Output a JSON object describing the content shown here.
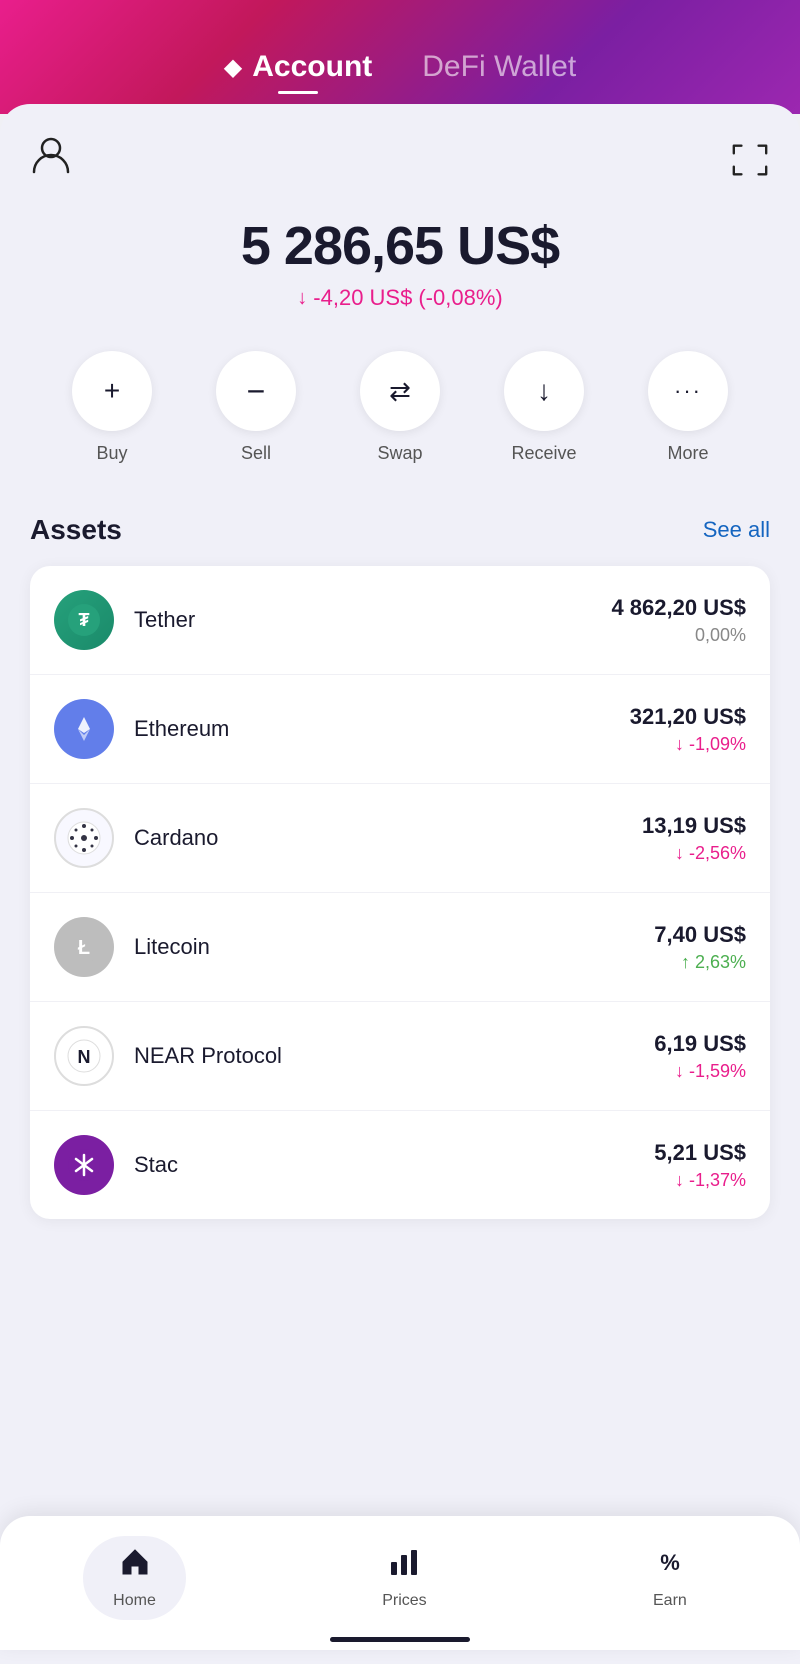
{
  "header": {
    "account_tab": "Account",
    "defi_tab": "DeFi Wallet",
    "diamond": "◆"
  },
  "balance": {
    "amount": "5 286,65 US$",
    "change": "-4,20 US$",
    "change_pct": "(-0,08%)",
    "change_direction": "down"
  },
  "actions": [
    {
      "id": "buy",
      "icon": "+",
      "label": "Buy"
    },
    {
      "id": "sell",
      "icon": "−",
      "label": "Sell"
    },
    {
      "id": "swap",
      "icon": "⇄",
      "label": "Swap"
    },
    {
      "id": "receive",
      "icon": "↓",
      "label": "Receive"
    },
    {
      "id": "more",
      "icon": "···",
      "label": "More"
    }
  ],
  "assets_section": {
    "title": "Assets",
    "see_all": "See all"
  },
  "assets": [
    {
      "id": "tether",
      "name": "Tether",
      "value": "4 862,20 US$",
      "change": "0,00%",
      "direction": "neutral",
      "icon_letter": "T",
      "icon_style": "tether"
    },
    {
      "id": "ethereum",
      "name": "Ethereum",
      "value": "321,20 US$",
      "change": "-1,09%",
      "direction": "down",
      "icon_letter": "◈",
      "icon_style": "eth"
    },
    {
      "id": "cardano",
      "name": "Cardano",
      "value": "13,19 US$",
      "change": "-2,56%",
      "direction": "down",
      "icon_letter": "✦",
      "icon_style": "ada"
    },
    {
      "id": "litecoin",
      "name": "Litecoin",
      "value": "7,40 US$",
      "change": "2,63%",
      "direction": "up",
      "icon_letter": "Ł",
      "icon_style": "ltc"
    },
    {
      "id": "near",
      "name": "NEAR Protocol",
      "value": "6,19 US$",
      "change": "-1,59%",
      "direction": "down",
      "icon_letter": "Ν",
      "icon_style": "near"
    },
    {
      "id": "stac",
      "name": "Stac",
      "value": "5,21 US$",
      "change": "-1,37%",
      "direction": "down",
      "icon_letter": "✳",
      "icon_style": "stac"
    }
  ],
  "bottom_nav": [
    {
      "id": "home",
      "icon": "🏠",
      "label": "Home",
      "active": true
    },
    {
      "id": "prices",
      "icon": "📊",
      "label": "Prices",
      "active": false
    },
    {
      "id": "earn",
      "icon": "%",
      "label": "Earn",
      "active": false
    }
  ]
}
